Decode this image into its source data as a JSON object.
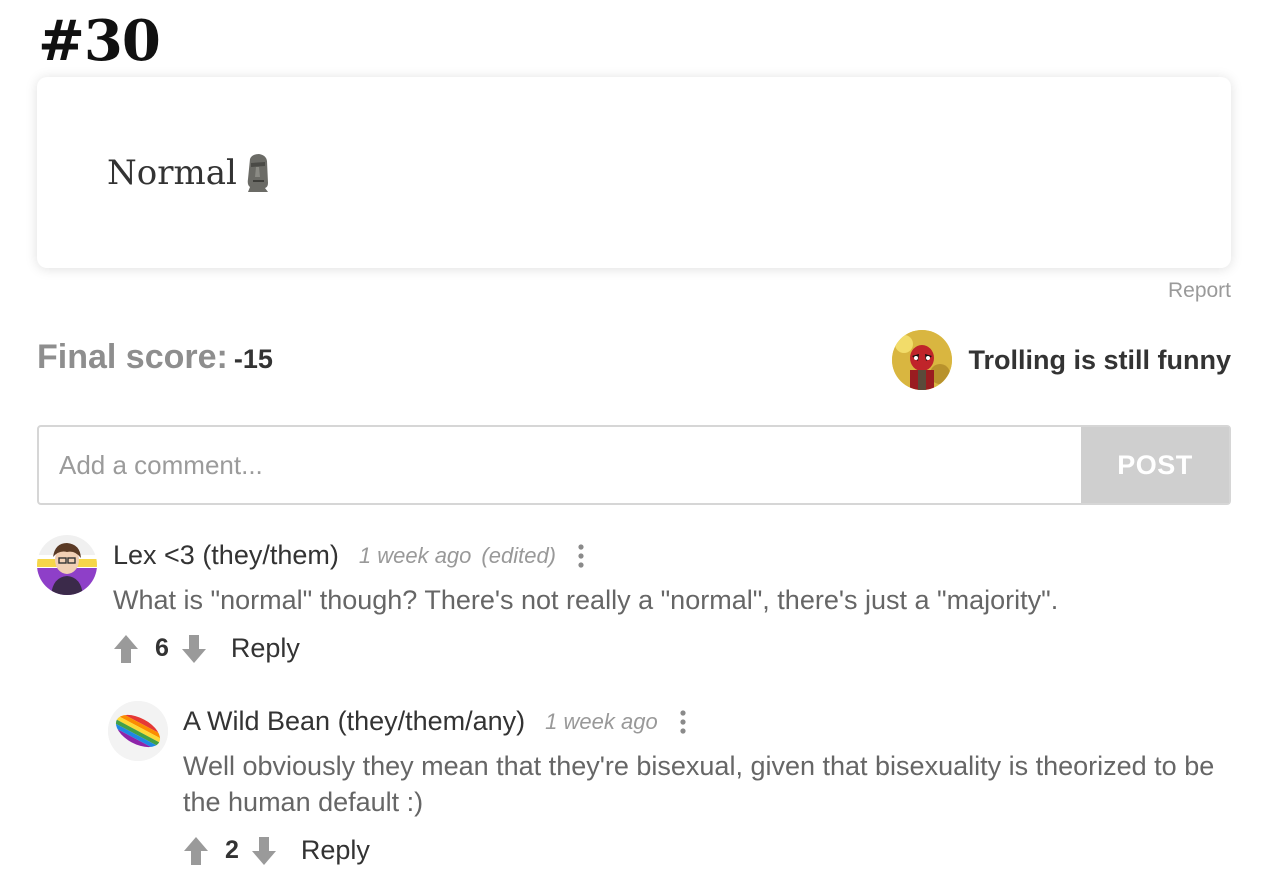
{
  "page": {
    "title": "#30"
  },
  "post": {
    "text": "Normal",
    "emoji_icon": "moai-icon",
    "report_label": "Report"
  },
  "score": {
    "label": "Final score:",
    "value": "-15"
  },
  "author": {
    "name": "Trolling is still funny",
    "avatar_icon": "avatar"
  },
  "comment_form": {
    "placeholder": "Add a comment...",
    "post_label": "POST"
  },
  "comments": [
    {
      "name": "Lex <3 (they/them)",
      "time": "1 week ago",
      "edited": "(edited)",
      "text": "What is \"normal\" though? There's not really a \"normal\", there's just a \"majority\".",
      "votes": "6",
      "reply_label": "Reply",
      "replies": [
        {
          "name": "A Wild Bean (they/them/any)",
          "time": "1 week ago",
          "text": "Well obviously they mean that they're bisexual, given that bisexuality is theorized to be the human default :)",
          "votes": "2",
          "reply_label": "Reply"
        }
      ]
    }
  ],
  "colors": {
    "post_button_bg": "#cfcfcf",
    "score_label": "#8e8e8e",
    "muted_text": "#999999"
  }
}
